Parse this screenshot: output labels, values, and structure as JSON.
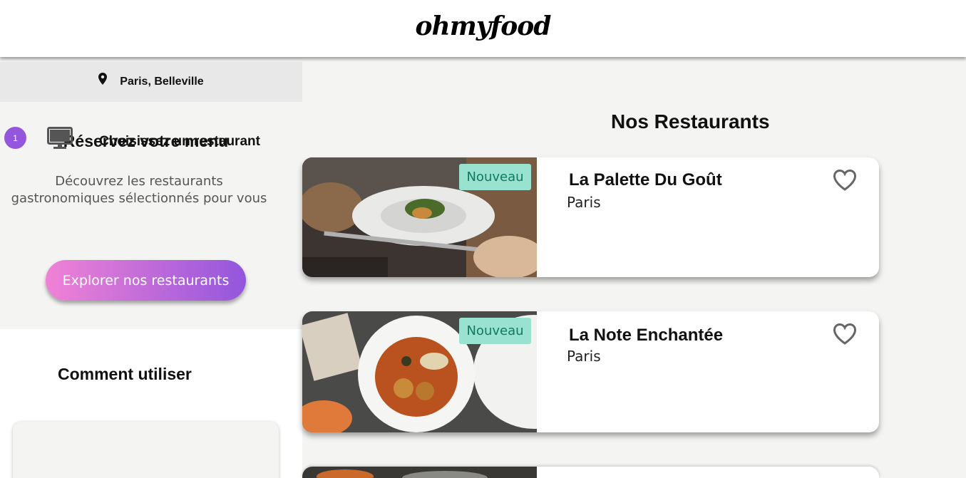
{
  "header": {
    "logo": "ohmyfood"
  },
  "location": {
    "icon": "map-pin-icon",
    "label": "Paris, Belleville"
  },
  "hero": {
    "title": "Réservez votre menu",
    "description": "Découvrez les restaurants gastronomiques sélectionnés pour vous",
    "button_label": "Explorer nos restaurants"
  },
  "how_to": {
    "title": "Comment utiliser",
    "steps": [
      {
        "number": "1",
        "icon": "computer-icon",
        "label": "Choisissez un restaurant"
      }
    ]
  },
  "restaurants": {
    "title": "Nos Restaurants",
    "items": [
      {
        "name": "La Palette Du Goût",
        "city": "Paris",
        "badge": "Nouveau"
      },
      {
        "name": "La Note Enchantée",
        "city": "Paris",
        "badge": "Nouveau"
      },
      {
        "name": "",
        "city": "",
        "badge": ""
      }
    ]
  },
  "colors": {
    "accent_start": "#f082d6",
    "accent_end": "#9356dc",
    "badge_bg": "#99e2d0",
    "badge_text": "#0f7a5f"
  }
}
